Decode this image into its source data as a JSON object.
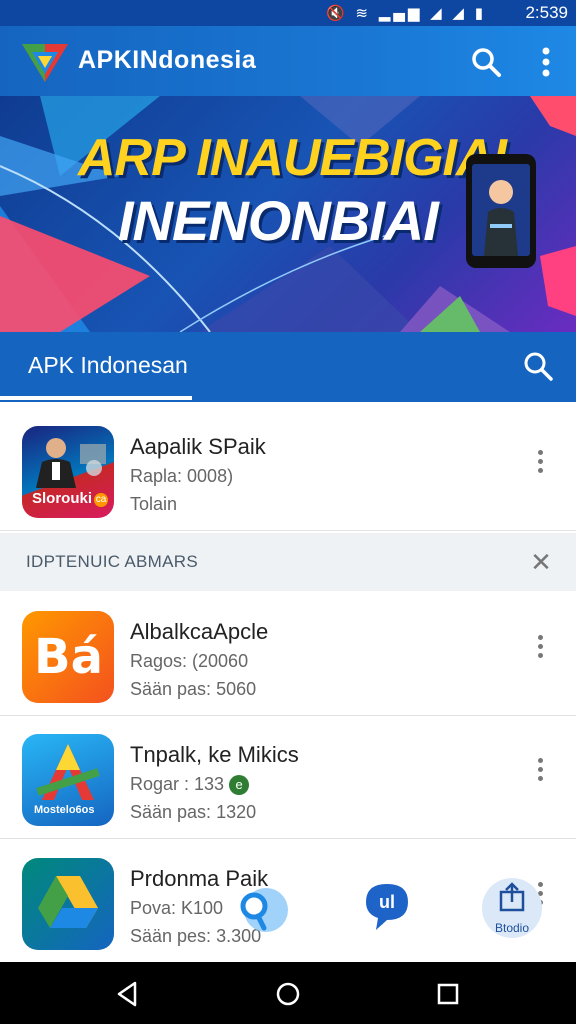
{
  "status_bar": {
    "icons": [
      "mute-icon",
      "wifi-icon",
      "signal-icon",
      "signal-icon",
      "signal-icon",
      "battery-icon"
    ],
    "time": "2:539"
  },
  "app_bar": {
    "brand": "APKINdonesia",
    "brand_prefix": "APK",
    "brand_suffix": "INdonesia",
    "actions": [
      "search-icon",
      "more-vert-icon"
    ]
  },
  "banner": {
    "headline_line1": "ARP INAUEBIGIAI",
    "headline_line2": "INENONBIAI",
    "colors": {
      "line1": "#ffd21f",
      "line2": "#ffffff"
    }
  },
  "tab_bar": {
    "label": "APK Indonesan",
    "action": "search-icon"
  },
  "featured": {
    "title": "Aapalik SPaik",
    "sub1": "Rapla: 0008)",
    "sub2": "Tolain",
    "icon_caption": "Slorouki",
    "icon_badge": "ca"
  },
  "section": {
    "label": "IDPTENUIC ABMARS",
    "close": "close-icon"
  },
  "apps": [
    {
      "title": "AlbalkcaApcle",
      "sub1": "Ragos: (20060",
      "sub2": "Sään pas: 5060",
      "icon_text": "Bá",
      "icon": "b-app-icon"
    },
    {
      "title": "Tnpalk, ke Mikics",
      "sub1": "Rogar : 133",
      "sub2": "Sään pas: 1320",
      "icon_caption": "Mostelo6os",
      "icon": "a-app-icon",
      "badge": "e"
    },
    {
      "title": "Prdonma Paik",
      "sub1": "Povа: K100",
      "sub2": "Sään pes: 3.300",
      "icon": "drive-icon"
    }
  ],
  "floating": {
    "studio_label": "Btodio"
  },
  "nav": [
    "back-icon",
    "home-icon",
    "recents-icon"
  ]
}
